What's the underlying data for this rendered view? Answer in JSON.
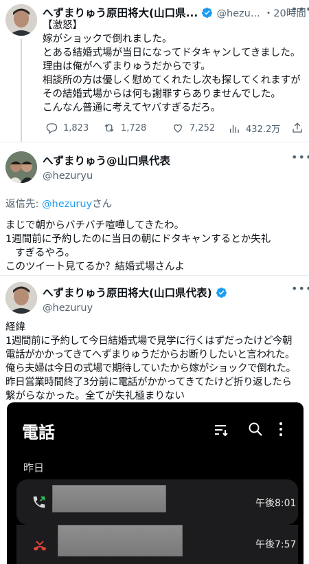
{
  "tweet1": {
    "name": "へずまりゅう原田将大(山口県...",
    "handle": "@hezu...",
    "time": "・20時間",
    "lines": [
      "【激怒】",
      "嫁がショックで倒れました。",
      "とある結婚式場が当日になってドタキャンしてきました。",
      "理由は俺がへずまりゅうだからです。",
      "相談所の方は優しく慰めてくれたし次も探してくれますが",
      "その結婚式場からは何も謝罪すらありませんでした。",
      "こんなん普通に考えてヤバすぎるだろ。"
    ],
    "stats": {
      "replies": "1,823",
      "retweets": "1,728",
      "likes": "7,252",
      "views": "432.2万"
    }
  },
  "tweet2": {
    "name": "へずまりゅう@山口県代表",
    "handle": "@hezuryu",
    "reply_prefix": "返信先: ",
    "reply_to": "@hezuruy",
    "reply_suffix": "さん",
    "lines": [
      "まじで朝からバチバチ喧嘩してきたわ。",
      "1週間前に予約したのに当日の朝にドタキャンするとか失礼",
      "すぎるやろ。",
      "このツイート見てるか？結婚式場さんよ"
    ]
  },
  "tweet3": {
    "name": "へずまりゅう原田将大(山口県代表)",
    "handle": "@hezuruy",
    "lines": [
      "経緯",
      "1週間前に予約して今日結婚式場で見学に行くはずだったけど今朝",
      "電話がかかってきてへずまりゅうだからお断りしたいと言われた。",
      "俺ら夫婦は今日の式場で期待していたから嫁がショックで倒れた。",
      "昨日営業時間終了3分前に電話がかかってきてたけど折り返したら",
      "繋がらなかった。全てが失礼極まりない"
    ]
  },
  "phone": {
    "title": "電話",
    "section": "昨日",
    "calls": [
      {
        "time": "午後8:01",
        "type": "outgoing"
      },
      {
        "time": "午後7:57",
        "type": "missed"
      }
    ]
  },
  "colors": {
    "accent": "#1d9bf0",
    "muted": "#536471",
    "missed": "#e0433a",
    "outgoing": "#34c759"
  }
}
